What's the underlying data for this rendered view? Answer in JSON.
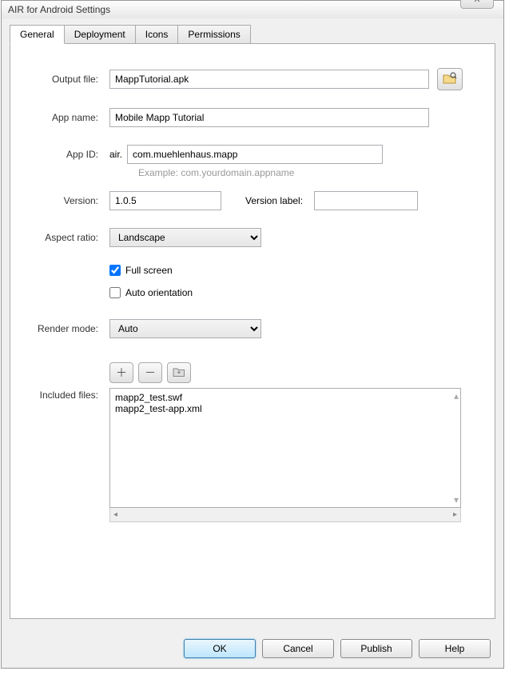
{
  "window": {
    "title": "AIR for Android Settings"
  },
  "tabs": {
    "general": "General",
    "deployment": "Deployment",
    "icons": "Icons",
    "permissions": "Permissions"
  },
  "labels": {
    "outputFile": "Output file:",
    "appName": "App name:",
    "appId": "App ID:",
    "airPrefix": "air.",
    "example": "Example: com.yourdomain.appname",
    "version": "Version:",
    "versionLabel": "Version label:",
    "aspectRatio": "Aspect ratio:",
    "fullScreen": "Full screen",
    "autoOrientation": "Auto orientation",
    "renderMode": "Render mode:",
    "includedFiles": "Included files:"
  },
  "values": {
    "outputFile": "MappTutorial.apk",
    "appName": "Mobile Mapp Tutorial",
    "appId": "com.muehlenhaus.mapp",
    "version": "1.0.5",
    "versionLabel": "",
    "aspectRatio": "Landscape",
    "renderMode": "Auto",
    "fullScreenChecked": true,
    "autoOrientationChecked": false
  },
  "includedFiles": [
    "mapp2_test.swf",
    "mapp2_test-app.xml"
  ],
  "buttons": {
    "ok": "OK",
    "cancel": "Cancel",
    "publish": "Publish",
    "help": "Help"
  }
}
